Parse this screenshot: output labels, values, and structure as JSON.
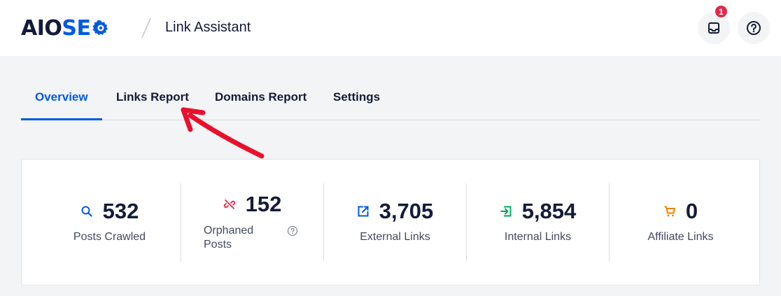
{
  "header": {
    "logo_left": "AIO",
    "logo_right": "SE",
    "page_name": "Link Assistant",
    "notification_count": "1"
  },
  "tabs": [
    {
      "label": "Overview",
      "active": true
    },
    {
      "label": "Links Report",
      "active": false
    },
    {
      "label": "Domains Report",
      "active": false
    },
    {
      "label": "Settings",
      "active": false
    }
  ],
  "stats": [
    {
      "value": "532",
      "label": "Posts Crawled",
      "icon": "search-icon",
      "color": "#005ae0"
    },
    {
      "value": "152",
      "label_line1": "Orphaned",
      "label_line2": "Posts",
      "icon": "broken-link-icon",
      "color": "#df2a4a"
    },
    {
      "value": "3,705",
      "label": "External Links",
      "icon": "external-link-icon",
      "color": "#005ae0"
    },
    {
      "value": "5,854",
      "label": "Internal Links",
      "icon": "internal-link-icon",
      "color": "#00aa63"
    },
    {
      "value": "0",
      "label": "Affiliate Links",
      "icon": "cart-icon",
      "color": "#f18200"
    }
  ],
  "colors": {
    "brand_blue": "#005ae0",
    "annotation_red": "#e8102c"
  }
}
